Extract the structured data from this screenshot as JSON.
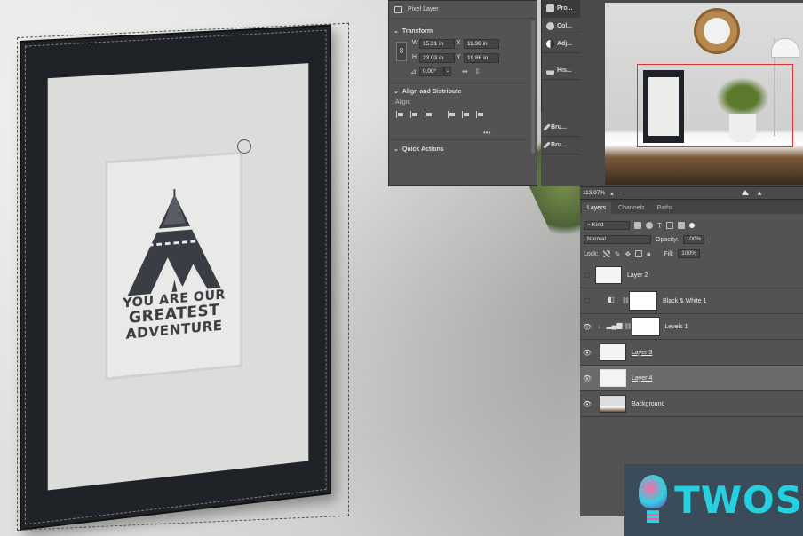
{
  "artwork": {
    "line1": "YOU ARE OUR",
    "line2": "GREATEST",
    "line3": "ADVENTURE"
  },
  "properties": {
    "header": "Pixel Layer",
    "transform_title": "Transform",
    "w_label": "W",
    "w_value": "15.31 in",
    "x_label": "X",
    "x_value": "11.38 in",
    "h_label": "H",
    "h_value": "23.03 in",
    "y_label": "Y",
    "y_value": "19.86 in",
    "angle_value": "0.00°",
    "align_title": "Align and Distribute",
    "align_label": "Align:",
    "more": "•••",
    "quick_title": "Quick Actions"
  },
  "strip": {
    "items": [
      "Pro...",
      "Col...",
      "Adj...",
      "His...",
      "Bru...",
      "Bru..."
    ]
  },
  "navigator": {
    "zoom": "113.97%"
  },
  "layers_panel": {
    "tabs": [
      "Layers",
      "Channels",
      "Paths"
    ],
    "kind": "Kind",
    "blend": "Normal",
    "opacity_label": "Opacity:",
    "opacity_value": "100%",
    "lock_label": "Lock:",
    "fill_label": "Fill:",
    "fill_value": "100%",
    "layers": [
      {
        "name": "Layer 2"
      },
      {
        "name": "Black & White 1"
      },
      {
        "name": "Levels 1"
      },
      {
        "name": "Layer 3"
      },
      {
        "name": "Layer 4"
      },
      {
        "name": "Background"
      }
    ]
  },
  "badge": {
    "text": "TWOS"
  }
}
